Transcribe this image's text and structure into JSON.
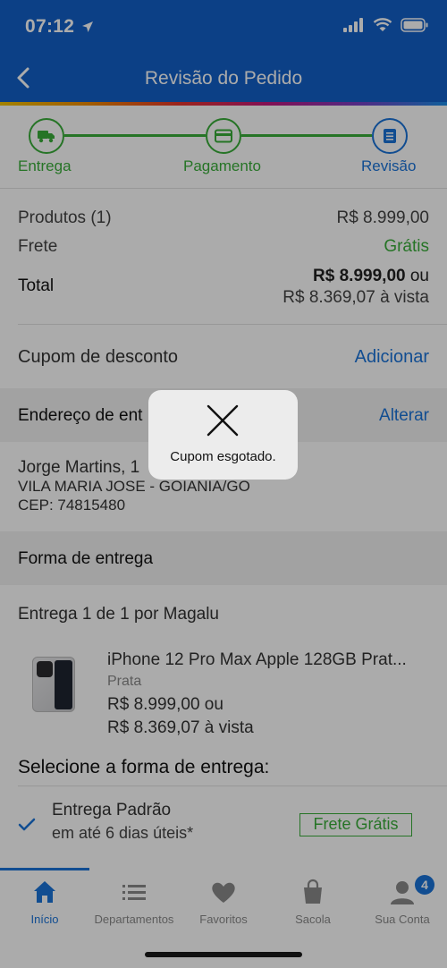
{
  "status": {
    "time": "07:12"
  },
  "header": {
    "title": "Revisão do Pedido"
  },
  "stepper": {
    "steps": [
      {
        "label": "Entrega"
      },
      {
        "label": "Pagamento"
      },
      {
        "label": "Revisão"
      }
    ]
  },
  "summary": {
    "products_label": "Produtos (1)",
    "products_value": "R$ 8.999,00",
    "shipping_label": "Frete",
    "shipping_value": "Grátis",
    "total_label": "Total",
    "total_value": "R$ 8.999,00",
    "total_or": "ou",
    "total_cash": "R$ 8.369,07 à vista"
  },
  "coupon": {
    "label": "Cupom de desconto",
    "action": "Adicionar"
  },
  "address": {
    "section_title": "Endereço de ent",
    "action": "Alterar",
    "name": "Jorge Martins, 1",
    "district": "VILA MARIA JOSE - GOIANIA/GO",
    "cep": "CEP: 74815480"
  },
  "delivery": {
    "section_title": "Forma de entrega",
    "delivery_count": "Entrega 1 de 1",
    "seller": "por Magalu",
    "product_name": "iPhone 12 Pro Max Apple 128GB Prat...",
    "product_color": "Prata",
    "product_price": "R$ 8.999,00 ou",
    "product_cash": "R$ 8.369,07 à vista",
    "select_title": "Selecione a forma de entrega:",
    "option_name": "Entrega Padrão",
    "option_time": "em até 6 dias úteis*",
    "option_badge": "Frete Grátis"
  },
  "toast": {
    "message": "Cupom esgotado."
  },
  "tabs": [
    {
      "label": "Início"
    },
    {
      "label": "Departamentos"
    },
    {
      "label": "Favoritos"
    },
    {
      "label": "Sacola"
    },
    {
      "label": "Sua Conta",
      "badge": "4"
    }
  ],
  "colors": {
    "primary": "#1260c8",
    "link": "#1a73d9",
    "success": "#3aae3a"
  }
}
